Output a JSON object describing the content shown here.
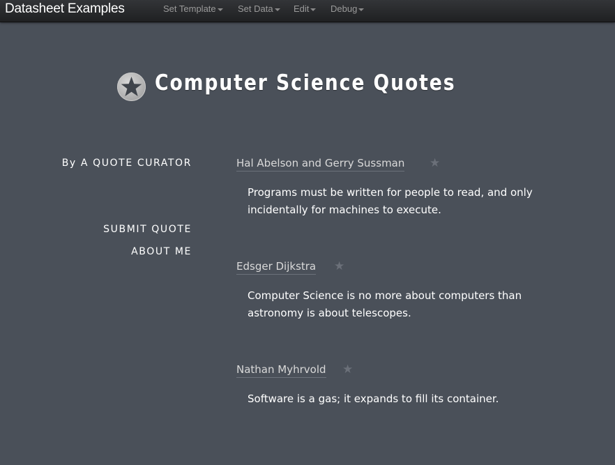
{
  "navbar": {
    "brand": "Datasheet Examples",
    "menus": [
      "Set Template",
      "Set Data",
      "Edit",
      "Debug"
    ]
  },
  "header": {
    "title": "Computer Science Quotes",
    "icon": "star-icon"
  },
  "sidebar": {
    "byline": "By A QUOTE CURATOR",
    "links": [
      "SUBMIT QUOTE",
      "ABOUT ME"
    ]
  },
  "quotes": [
    {
      "author": "Hal Abelson and Gerry Sussman",
      "text": "Programs must be written for people to read, and only incidentally for machines to execute."
    },
    {
      "author": "Edsger Dijkstra",
      "text": "Computer Science is no more about computers than astronomy is about telescopes."
    },
    {
      "author": "Nathan Myhrvold",
      "text": "Software is a gas; it expands to fill its container."
    }
  ],
  "colors": {
    "background": "#4a5059",
    "navbar": "#2a2c2f",
    "star": "#6b7079"
  }
}
